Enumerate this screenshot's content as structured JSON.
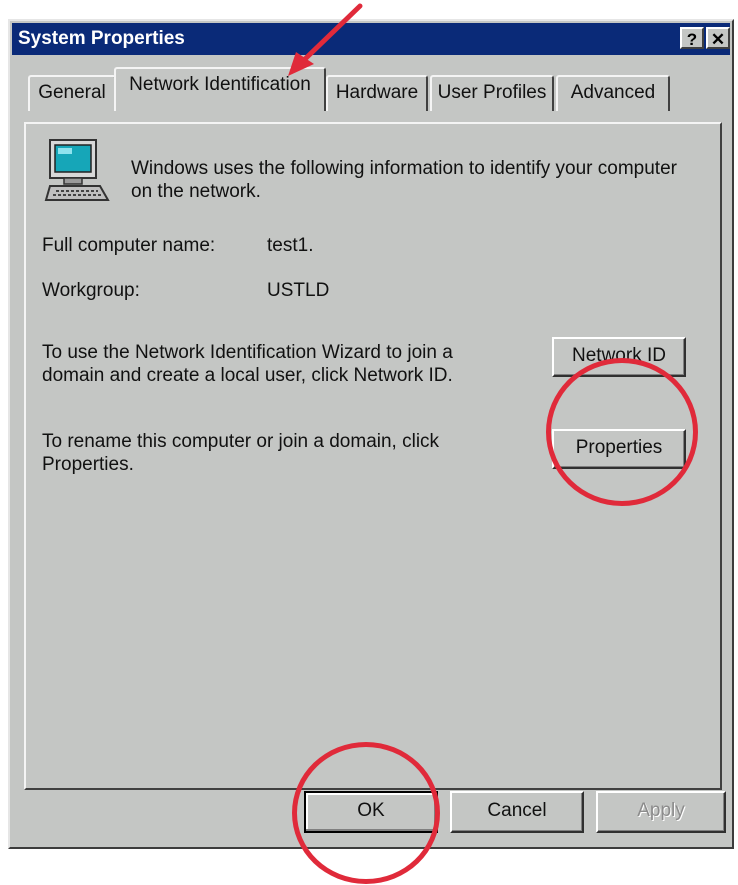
{
  "window": {
    "title": "System Properties",
    "help_glyph": "?",
    "close_glyph": "✕"
  },
  "tabs": [
    {
      "label": "General"
    },
    {
      "label": "Network Identification",
      "active": true
    },
    {
      "label": "Hardware"
    },
    {
      "label": "User Profiles"
    },
    {
      "label": "Advanced"
    }
  ],
  "panel": {
    "intro_line1": "Windows uses the following information to identify your computer",
    "intro_line2": "on the network.",
    "full_name_label": "Full computer name:",
    "full_name_value": "test1.",
    "workgroup_label": "Workgroup:",
    "workgroup_value": "USTLD",
    "wizard_line1": "To use the Network Identification Wizard to join a",
    "wizard_line2": "domain and create a local user, click Network ID.",
    "network_id_button": "Network ID",
    "rename_line1": "To rename this computer or join a domain, click",
    "rename_line2": "Properties.",
    "properties_button": "Properties"
  },
  "footer": {
    "ok": "OK",
    "cancel": "Cancel",
    "apply": "Apply"
  },
  "colors": {
    "titlebar": "#0a2a78",
    "dialog_bg": "#c4c6c4",
    "annotation": "#e02a3a"
  }
}
